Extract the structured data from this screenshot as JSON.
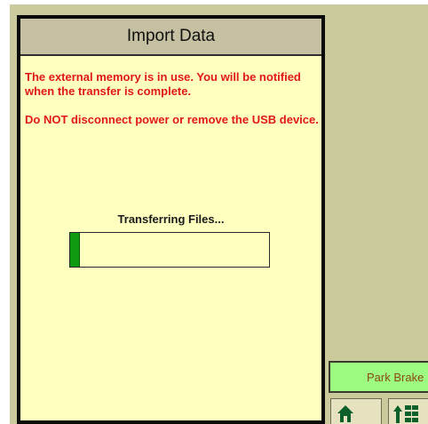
{
  "dialog": {
    "title": "Import Data",
    "message_1_line_1": "The external memory is in use.  You will be notified",
    "message_1_line_2": "when the transfer is complete.",
    "message_2": "Do NOT disconnect power or remove the USB device.",
    "progress_label": "Transferring Files...",
    "progress_fraction": 0.05
  },
  "status": {
    "park_brake_label": "Park Brake"
  },
  "nav": {
    "home_icon": "home-icon",
    "layout_icon": "up-arrow-grid-icon"
  },
  "colors": {
    "background": "#cbca9d",
    "dialog_body": "#ffffc0",
    "dialog_header": "#c4c0a1",
    "warning_text": "#e01818",
    "progress_fill": "#0f9a0f",
    "park_brake_bg": "#9dfb82",
    "icon_green": "#0b5f2a"
  }
}
